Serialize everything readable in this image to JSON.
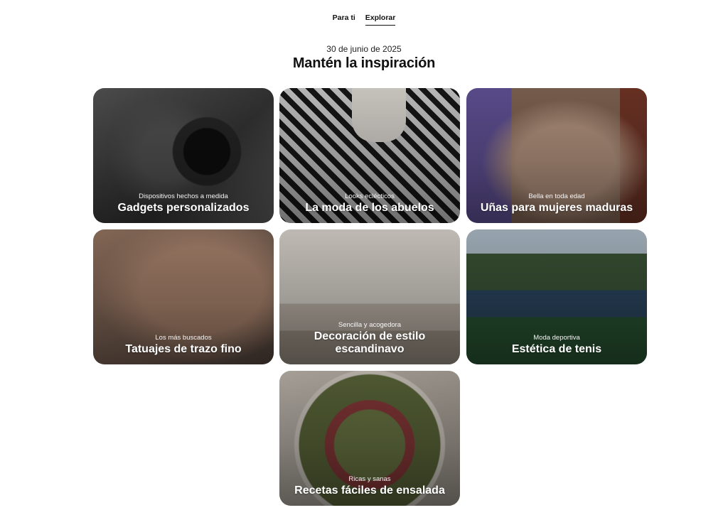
{
  "tabs": [
    {
      "label": "Para ti",
      "active": false
    },
    {
      "label": "Explorar",
      "active": true
    }
  ],
  "date": "30 de junio de 2025",
  "title": "Mantén la inspiración",
  "cards": [
    {
      "subtitle": "Dispositivos hechos a medida",
      "title": "Gadgets personalizados"
    },
    {
      "subtitle": "Looks eclécticos",
      "title": "La moda de los abuelos"
    },
    {
      "subtitle": "Bella en toda edad",
      "title": "Uñas para mujeres maduras"
    },
    {
      "subtitle": "Los más buscados",
      "title": "Tatuajes de trazo fino"
    },
    {
      "subtitle": "Sencilla y acogedora",
      "title": "Decoración de estilo escandinavo"
    },
    {
      "subtitle": "Moda deportiva",
      "title": "Estética de tenis"
    },
    {
      "subtitle": "Ricas y sanas",
      "title": "Recetas fáciles de ensalada"
    }
  ]
}
